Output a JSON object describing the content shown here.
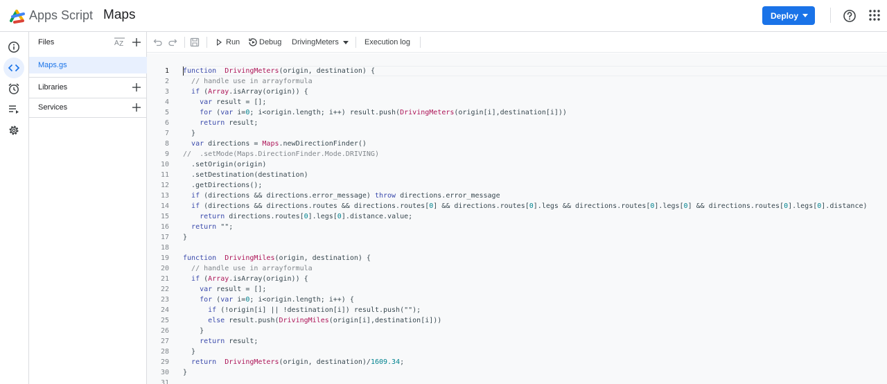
{
  "header": {
    "brand": "Apps Script",
    "project_title": "Maps",
    "deploy_label": "Deploy",
    "colors": {
      "accent": "#1a73e8"
    }
  },
  "rail": {
    "items": [
      {
        "name": "overview",
        "icon": "info-icon"
      },
      {
        "name": "editor",
        "icon": "code-icon",
        "active": true
      },
      {
        "name": "triggers",
        "icon": "alarm-icon"
      },
      {
        "name": "executions",
        "icon": "executions-icon"
      },
      {
        "name": "settings",
        "icon": "gear-icon"
      }
    ]
  },
  "files_panel": {
    "title": "Files",
    "files": [
      {
        "name": "Maps.gs",
        "selected": true
      }
    ],
    "sections": [
      {
        "label": "Libraries"
      },
      {
        "label": "Services"
      }
    ]
  },
  "toolbar": {
    "run_label": "Run",
    "debug_label": "Debug",
    "function_selected": "DrivingMeters",
    "execution_log_label": "Execution log"
  },
  "editor": {
    "current_line": 1,
    "lines": [
      {
        "n": "1",
        "t": [
          [
            "kw",
            "function"
          ],
          [
            "",
            "  "
          ],
          [
            "fn",
            "DrivingMeters"
          ],
          [
            "",
            "(origin, destination) {"
          ]
        ]
      },
      {
        "n": "2",
        "t": [
          [
            "",
            "  "
          ],
          [
            "cm",
            "// handle use in arrayformula"
          ]
        ]
      },
      {
        "n": "3",
        "t": [
          [
            "",
            "  "
          ],
          [
            "kw",
            "if"
          ],
          [
            "",
            " ("
          ],
          [
            "fn",
            "Array"
          ],
          [
            "",
            ".isArray(origin)) {"
          ]
        ]
      },
      {
        "n": "4",
        "t": [
          [
            "",
            "    "
          ],
          [
            "kw",
            "var"
          ],
          [
            "",
            " result = [];"
          ]
        ]
      },
      {
        "n": "5",
        "t": [
          [
            "",
            "    "
          ],
          [
            "kw",
            "for"
          ],
          [
            "",
            " ("
          ],
          [
            "kw",
            "var"
          ],
          [
            "",
            " i="
          ],
          [
            "nm",
            "0"
          ],
          [
            "",
            "; i<origin.length; i++) result.push("
          ],
          [
            "fn",
            "DrivingMeters"
          ],
          [
            "",
            "(origin[i],destination[i]))"
          ]
        ]
      },
      {
        "n": "6",
        "t": [
          [
            "",
            "    "
          ],
          [
            "kw",
            "return"
          ],
          [
            "",
            " result;"
          ]
        ]
      },
      {
        "n": "7",
        "t": [
          [
            "",
            "  }"
          ]
        ]
      },
      {
        "n": "8",
        "t": [
          [
            "",
            "  "
          ],
          [
            "kw",
            "var"
          ],
          [
            "",
            " directions = "
          ],
          [
            "fn",
            "Maps"
          ],
          [
            "",
            ".newDirectionFinder()"
          ]
        ]
      },
      {
        "n": "9",
        "t": [
          [
            "cm",
            "//  .setMode(Maps.DirectionFinder.Mode.DRIVING)"
          ]
        ]
      },
      {
        "n": "10",
        "t": [
          [
            "",
            "  .setOrigin(origin)"
          ]
        ]
      },
      {
        "n": "11",
        "t": [
          [
            "",
            "  .setDestination(destination)"
          ]
        ]
      },
      {
        "n": "12",
        "t": [
          [
            "",
            "  .getDirections();"
          ]
        ]
      },
      {
        "n": "13",
        "t": [
          [
            "",
            "  "
          ],
          [
            "kw",
            "if"
          ],
          [
            "",
            " (directions && directions.error_message) "
          ],
          [
            "kw",
            "throw"
          ],
          [
            "",
            " directions.error_message"
          ]
        ]
      },
      {
        "n": "14",
        "t": [
          [
            "",
            "  "
          ],
          [
            "kw",
            "if"
          ],
          [
            "",
            " (directions && directions.routes && directions.routes["
          ],
          [
            "nm",
            "0"
          ],
          [
            "",
            "] && directions.routes["
          ],
          [
            "nm",
            "0"
          ],
          [
            "",
            "].legs && directions.routes["
          ],
          [
            "nm",
            "0"
          ],
          [
            "",
            "].legs["
          ],
          [
            "nm",
            "0"
          ],
          [
            "",
            "] && directions.routes["
          ],
          [
            "nm",
            "0"
          ],
          [
            "",
            "].legs["
          ],
          [
            "nm",
            "0"
          ],
          [
            "",
            "].distance)"
          ]
        ]
      },
      {
        "n": "15",
        "t": [
          [
            "",
            "    "
          ],
          [
            "kw",
            "return"
          ],
          [
            "",
            " directions.routes["
          ],
          [
            "nm",
            "0"
          ],
          [
            "",
            "].legs["
          ],
          [
            "nm",
            "0"
          ],
          [
            "",
            "].distance.value;"
          ]
        ]
      },
      {
        "n": "16",
        "t": [
          [
            "",
            "  "
          ],
          [
            "kw",
            "return"
          ],
          [
            "",
            " \"\";"
          ]
        ]
      },
      {
        "n": "17",
        "t": [
          [
            "",
            "}"
          ]
        ]
      },
      {
        "n": "18",
        "t": []
      },
      {
        "n": "19",
        "t": [
          [
            "kw",
            "function"
          ],
          [
            "",
            "  "
          ],
          [
            "fn",
            "DrivingMiles"
          ],
          [
            "",
            "(origin, destination) {"
          ]
        ]
      },
      {
        "n": "20",
        "t": [
          [
            "",
            "  "
          ],
          [
            "cm",
            "// handle use in arrayformula"
          ]
        ]
      },
      {
        "n": "21",
        "t": [
          [
            "",
            "  "
          ],
          [
            "kw",
            "if"
          ],
          [
            "",
            " ("
          ],
          [
            "fn",
            "Array"
          ],
          [
            "",
            ".isArray(origin)) {"
          ]
        ]
      },
      {
        "n": "22",
        "t": [
          [
            "",
            "    "
          ],
          [
            "kw",
            "var"
          ],
          [
            "",
            " result = [];"
          ]
        ]
      },
      {
        "n": "23",
        "t": [
          [
            "",
            "    "
          ],
          [
            "kw",
            "for"
          ],
          [
            "",
            " ("
          ],
          [
            "kw",
            "var"
          ],
          [
            "",
            " i="
          ],
          [
            "nm",
            "0"
          ],
          [
            "",
            "; i<origin.length; i++) {"
          ]
        ]
      },
      {
        "n": "24",
        "t": [
          [
            "",
            "      "
          ],
          [
            "kw",
            "if"
          ],
          [
            "",
            " (!origin[i] || !destination[i]) result.push(\"\");"
          ]
        ]
      },
      {
        "n": "25",
        "t": [
          [
            "",
            "      "
          ],
          [
            "kw",
            "else"
          ],
          [
            "",
            " result.push("
          ],
          [
            "fn",
            "DrivingMiles"
          ],
          [
            "",
            "(origin[i],destination[i]))"
          ]
        ]
      },
      {
        "n": "26",
        "t": [
          [
            "",
            "    }"
          ]
        ]
      },
      {
        "n": "27",
        "t": [
          [
            "",
            "    "
          ],
          [
            "kw",
            "return"
          ],
          [
            "",
            " result;"
          ]
        ]
      },
      {
        "n": "28",
        "t": [
          [
            "",
            "  }"
          ]
        ]
      },
      {
        "n": "29",
        "t": [
          [
            "",
            "  "
          ],
          [
            "kw",
            "return"
          ],
          [
            "",
            "  "
          ],
          [
            "fn",
            "DrivingMeters"
          ],
          [
            "",
            "(origin, destination)/"
          ],
          [
            "nm",
            "1609.34"
          ],
          [
            "",
            ";"
          ]
        ]
      },
      {
        "n": "30",
        "t": [
          [
            "",
            "}"
          ]
        ]
      },
      {
        "n": "31",
        "t": []
      }
    ]
  }
}
